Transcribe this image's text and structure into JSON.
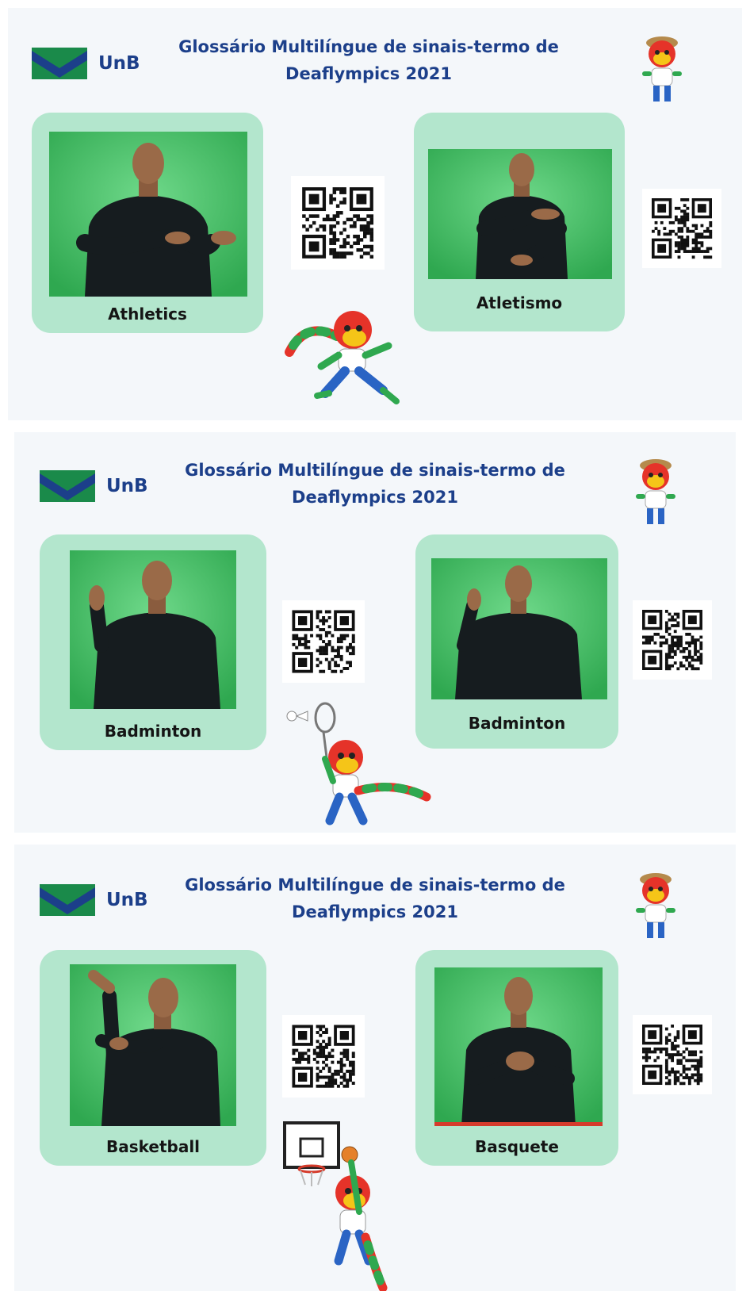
{
  "panels": [
    {
      "logo_text": "UnB",
      "title_line1": "Glossário Multilíngue de sinais-termo de",
      "title_line2": "Deaflympics 2021",
      "cards": [
        {
          "caption": "Athletics",
          "pose": "hands-forward"
        },
        {
          "caption": "Atletismo",
          "pose": "hands-chest"
        }
      ],
      "mascot_action": "running"
    },
    {
      "logo_text": "UnB",
      "title_line1": "Glossário Multilíngue de sinais-termo de",
      "title_line2": "Deaflympics 2021",
      "cards": [
        {
          "caption": "Badminton",
          "pose": "hand-raised"
        },
        {
          "caption": "Badminton",
          "pose": "hand-raised"
        }
      ],
      "mascot_action": "badminton"
    },
    {
      "logo_text": "UnB",
      "title_line1": "Glossário Multilíngue de sinais-termo de",
      "title_line2": "Deaflympics 2021",
      "cards": [
        {
          "caption": "Basketball",
          "pose": "arm-up"
        },
        {
          "caption": "Basquete",
          "pose": "hands-chest"
        }
      ],
      "mascot_action": "basketball"
    }
  ],
  "colors": {
    "title": "#1c3f8a",
    "card": "#b3e6cd",
    "panel_bg": "#f4f7fa",
    "green_screen": "#3fc063",
    "flag_green": "#1a8a4a",
    "flag_blue": "#1c3f8a"
  }
}
